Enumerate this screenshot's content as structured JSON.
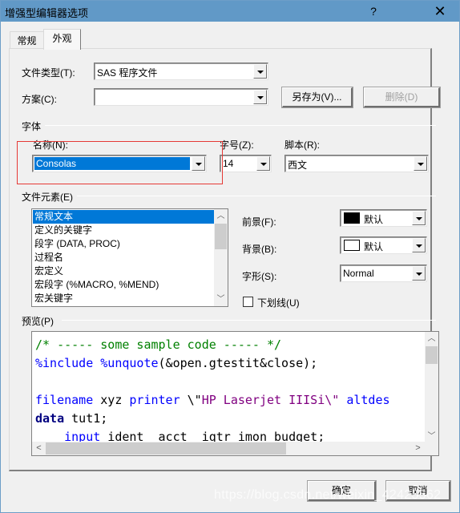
{
  "window": {
    "title": "增强型编辑器选项",
    "help_label": "?",
    "close_label": "✕"
  },
  "tabs": [
    {
      "label": "常规",
      "active": false
    },
    {
      "label": "外观",
      "active": true
    }
  ],
  "file_type": {
    "label": "文件类型(T):",
    "value": "SAS 程序文件"
  },
  "scheme": {
    "label": "方案(C):",
    "value": "",
    "save_as_label": "另存为(V)...",
    "delete_label": "删除(D)",
    "delete_enabled": false
  },
  "font_group": {
    "label": "字体",
    "name_label": "名称(N):",
    "name_value": "Consolas",
    "size_label": "字号(Z):",
    "size_value": "14",
    "script_label": "脚本(R):",
    "script_value": "西文"
  },
  "file_elements": {
    "label": "文件元素(E)",
    "items": [
      "常规文本",
      "定义的关键字",
      "段字 (DATA, PROC)",
      "过程名",
      "宏定义",
      "宏段字 (%MACRO, %MEND)",
      "宏关键字"
    ],
    "selected_index": 0,
    "foreground": {
      "label": "前景(F):",
      "value": "默认",
      "swatch_color": "#000000"
    },
    "background": {
      "label": "背景(B):",
      "value": "默认",
      "swatch_color": "#ffffff"
    },
    "style": {
      "label": "字形(S):",
      "value": "Normal"
    },
    "underline": {
      "label": "下划线(U)",
      "checked": false
    }
  },
  "preview": {
    "label": "预览(P)",
    "lines": [
      [
        {
          "text": "/* ----- some sample code ----- */",
          "color": "#008000",
          "bold": false
        }
      ],
      [
        {
          "text": "%include",
          "color": "#0000ff",
          "bold": false
        },
        {
          "text": " ",
          "color": "#000000",
          "bold": false
        },
        {
          "text": "%unquote",
          "color": "#0000ff",
          "bold": false
        },
        {
          "text": "(&open.gtestit&close);",
          "color": "#000000",
          "bold": false
        }
      ],
      [],
      [
        {
          "text": "filename",
          "color": "#0000ff",
          "bold": false
        },
        {
          "text": " xyz ",
          "color": "#000000",
          "bold": false
        },
        {
          "text": "printer",
          "color": "#0000ff",
          "bold": false
        },
        {
          "text": " \\\"",
          "color": "#000000",
          "bold": false
        },
        {
          "text": "HP Laserjet IIISi\\\"",
          "color": "#800080",
          "bold": false
        },
        {
          "text": " ",
          "color": "#000000",
          "bold": false
        },
        {
          "text": "altdes",
          "color": "#0000ff",
          "bold": false
        }
      ],
      [
        {
          "text": "data",
          "color": "#000080",
          "bold": true
        },
        {
          "text": " tut1;",
          "color": "#000000",
          "bold": false
        }
      ],
      [
        {
          "text": "    input",
          "color": "#0000ff",
          "bold": false
        },
        {
          "text": " ident  acct  iqtr imon budget;",
          "color": "#000000",
          "bold": false
        }
      ]
    ]
  },
  "footer": {
    "ok_label": "确定",
    "cancel_label": "取消"
  },
  "watermark": "https://blog.csdn.net/weixin_42425562"
}
